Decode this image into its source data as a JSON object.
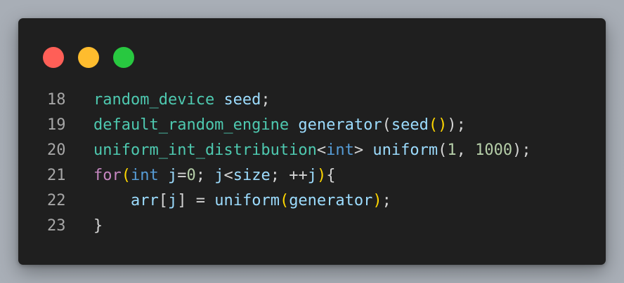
{
  "window": {
    "traffic_lights": [
      {
        "name": "close",
        "color": "#ff5f57"
      },
      {
        "name": "minimize",
        "color": "#febc2e"
      },
      {
        "name": "zoom",
        "color": "#28c840"
      }
    ]
  },
  "code": {
    "language": "cpp",
    "lines": [
      {
        "number": "18",
        "tokens": [
          {
            "text": "random_device",
            "kind": "type"
          },
          {
            "text": " ",
            "kind": "op"
          },
          {
            "text": "seed",
            "kind": "var"
          },
          {
            "text": ";",
            "kind": "op"
          }
        ]
      },
      {
        "number": "19",
        "tokens": [
          {
            "text": "default_random_engine",
            "kind": "type"
          },
          {
            "text": " ",
            "kind": "op"
          },
          {
            "text": "generator",
            "kind": "var"
          },
          {
            "text": "(",
            "kind": "op"
          },
          {
            "text": "seed",
            "kind": "var"
          },
          {
            "text": "()",
            "kind": "br1"
          },
          {
            "text": ");",
            "kind": "op"
          }
        ]
      },
      {
        "number": "20",
        "tokens": [
          {
            "text": "uniform_int_distribution",
            "kind": "type"
          },
          {
            "text": "<",
            "kind": "op"
          },
          {
            "text": "int",
            "kind": "kwb"
          },
          {
            "text": "> ",
            "kind": "op"
          },
          {
            "text": "uniform",
            "kind": "var"
          },
          {
            "text": "(",
            "kind": "op"
          },
          {
            "text": "1",
            "kind": "num"
          },
          {
            "text": ", ",
            "kind": "op"
          },
          {
            "text": "1000",
            "kind": "num"
          },
          {
            "text": ");",
            "kind": "op"
          }
        ]
      },
      {
        "number": "21",
        "tokens": [
          {
            "text": "for",
            "kind": "kw"
          },
          {
            "text": "(",
            "kind": "br1"
          },
          {
            "text": "int",
            "kind": "kwb"
          },
          {
            "text": " ",
            "kind": "op"
          },
          {
            "text": "j",
            "kind": "var"
          },
          {
            "text": "=",
            "kind": "op"
          },
          {
            "text": "0",
            "kind": "num"
          },
          {
            "text": "; ",
            "kind": "op"
          },
          {
            "text": "j",
            "kind": "var"
          },
          {
            "text": "<",
            "kind": "op"
          },
          {
            "text": "size",
            "kind": "var"
          },
          {
            "text": "; ++",
            "kind": "op"
          },
          {
            "text": "j",
            "kind": "var"
          },
          {
            "text": ")",
            "kind": "br1"
          },
          {
            "text": "{",
            "kind": "op"
          }
        ]
      },
      {
        "number": "22",
        "tokens": [
          {
            "text": "    ",
            "kind": "op"
          },
          {
            "text": "arr",
            "kind": "var"
          },
          {
            "text": "[",
            "kind": "op"
          },
          {
            "text": "j",
            "kind": "var"
          },
          {
            "text": "] = ",
            "kind": "op"
          },
          {
            "text": "uniform",
            "kind": "var"
          },
          {
            "text": "(",
            "kind": "br1"
          },
          {
            "text": "generator",
            "kind": "var"
          },
          {
            "text": ")",
            "kind": "br1"
          },
          {
            "text": ";",
            "kind": "op"
          }
        ]
      },
      {
        "number": "23",
        "tokens": [
          {
            "text": "}",
            "kind": "op"
          }
        ]
      }
    ]
  }
}
